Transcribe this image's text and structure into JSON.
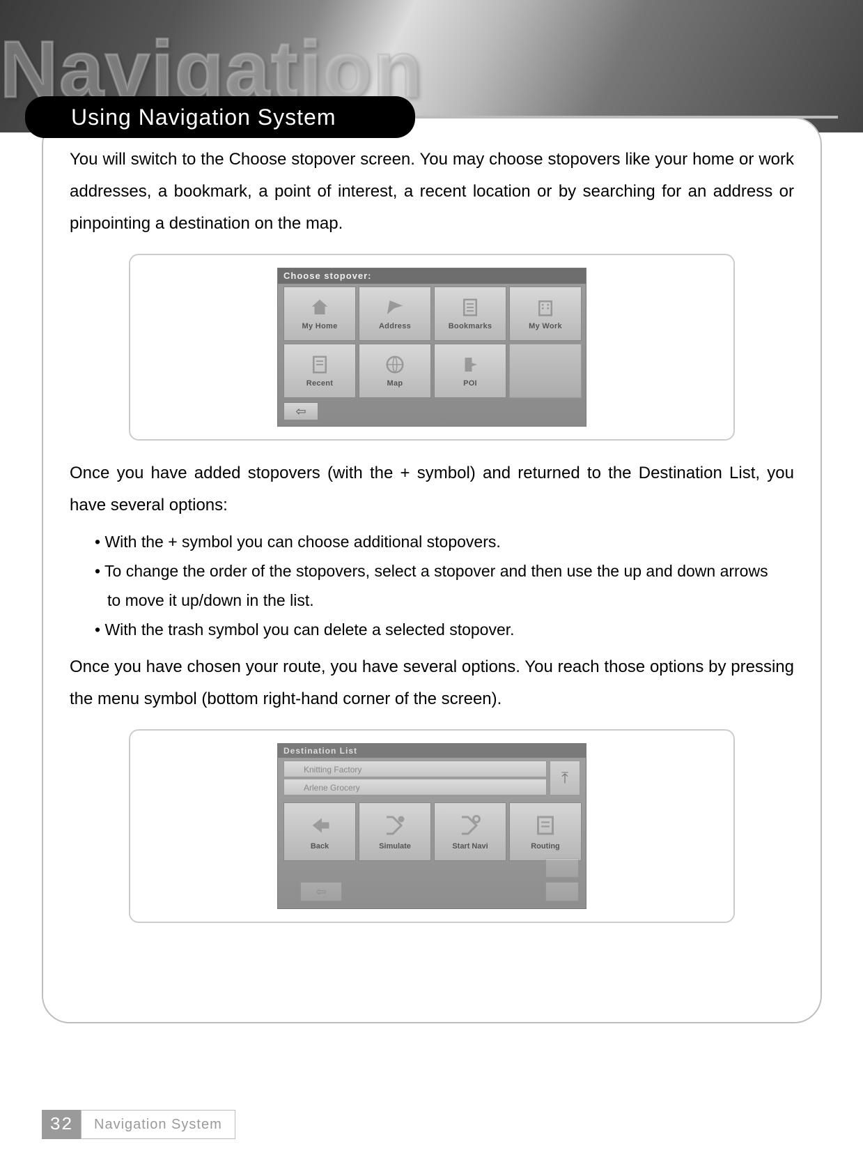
{
  "ghost_title": "Navigation",
  "section_title": "Using Navigation System",
  "para1": "You will switch to the Choose stopover screen. You may choose stopovers like your home or work addresses, a bookmark, a point of interest, a recent location or by searching for an address or pinpointing a destination on the map.",
  "para2": "Once you have added stopovers (with the + symbol) and returned to the Destination List, you have several options:",
  "bullets": [
    "With the + symbol you can choose additional stopovers.",
    "To change the order of the stopovers, select a stopover and then use the up and down arrows",
    "to move it up/down in the list.",
    "With the trash symbol you can delete a selected stopover."
  ],
  "para3": "Once you have chosen your route, you have several options. You reach those options by pressing the menu symbol (bottom right-hand corner of the screen).",
  "screen1": {
    "title": "Choose stopover:",
    "buttons": [
      {
        "label": "My Home"
      },
      {
        "label": "Address"
      },
      {
        "label": "Bookmarks"
      },
      {
        "label": "My Work"
      },
      {
        "label": "Recent"
      },
      {
        "label": "Map"
      },
      {
        "label": "POI"
      }
    ]
  },
  "screen2": {
    "title": "Destination List",
    "row1": "Knitting Factory",
    "row2": "Arlene Grocery",
    "buttons": [
      {
        "label": "Back"
      },
      {
        "label": "Simulate"
      },
      {
        "label": "Start Navi"
      },
      {
        "label": "Routing"
      }
    ]
  },
  "footer": {
    "page": "32",
    "label": "Navigation System"
  }
}
